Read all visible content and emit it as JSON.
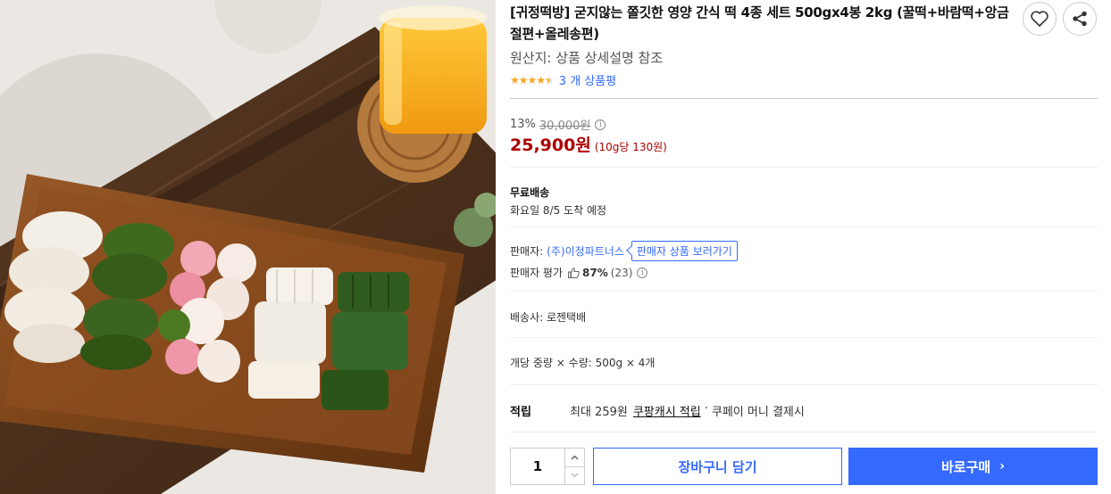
{
  "product": {
    "title": "[귀정떡방] 굳지않는 쫄깃한 영양 간식 떡 4종 세트 500gx4봉 2kg (꿀떡+바람떡+앙금절편+올레송편)",
    "origin": "원산지: 상품 상세설명 참조",
    "rating_stars": 4.5,
    "review_link": "3 개 상품평",
    "image_alt": "wooden tray of assorted rice cakes with orange juice"
  },
  "actions": {
    "wishlist_icon": "heart-icon",
    "share_icon": "share-icon"
  },
  "price": {
    "discount_rate": "13%",
    "original": "30,000원",
    "info_icon": "i",
    "sale": "25,900원",
    "unit": "(10g당 130원)"
  },
  "shipping": {
    "type": "무료배송",
    "arrival": "화요일 8/5 도착 예정"
  },
  "seller": {
    "label": "판매자:",
    "name": "(주)이정파트너스",
    "link": "판매자 상품 보러가기",
    "rating_label": "판매자 평가",
    "rating_pct": "87%",
    "rating_count": "(23)"
  },
  "carrier": "배송사:  로젠택배",
  "weight": "개당 중량 × 수량: 500g × 4개",
  "reward": {
    "label": "적립",
    "max": "최대 259원",
    "link": "쿠팡캐시 적립",
    "sep": "·",
    "tail": "쿠페이 머니 결제시"
  },
  "purchase": {
    "quantity": "1",
    "cart_label": "장바구니 담기",
    "buy_label": "바로구매",
    "buy_chevron": "›"
  },
  "colors": {
    "accent": "#346aff",
    "price_red": "#ae0000",
    "star": "#f5a623"
  }
}
